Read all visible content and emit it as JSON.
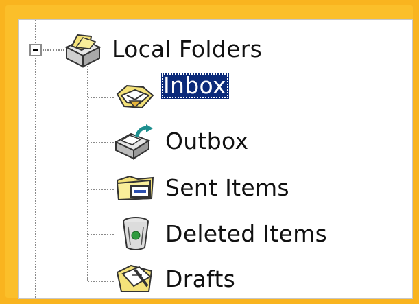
{
  "tree": {
    "root": {
      "label": "Local Folders",
      "icon": "local-folders-icon",
      "expanded": true
    },
    "children": [
      {
        "label": "Inbox",
        "icon": "inbox-icon",
        "selected": true
      },
      {
        "label": "Outbox",
        "icon": "outbox-icon",
        "selected": false
      },
      {
        "label": "Sent Items",
        "icon": "sent-items-icon",
        "selected": false
      },
      {
        "label": "Deleted Items",
        "icon": "deleted-items-icon",
        "selected": false
      },
      {
        "label": "Drafts",
        "icon": "drafts-icon",
        "selected": false
      }
    ]
  },
  "colors": {
    "frame": "#f9b41f",
    "selection": "#0b2a7a",
    "text": "#111111"
  }
}
